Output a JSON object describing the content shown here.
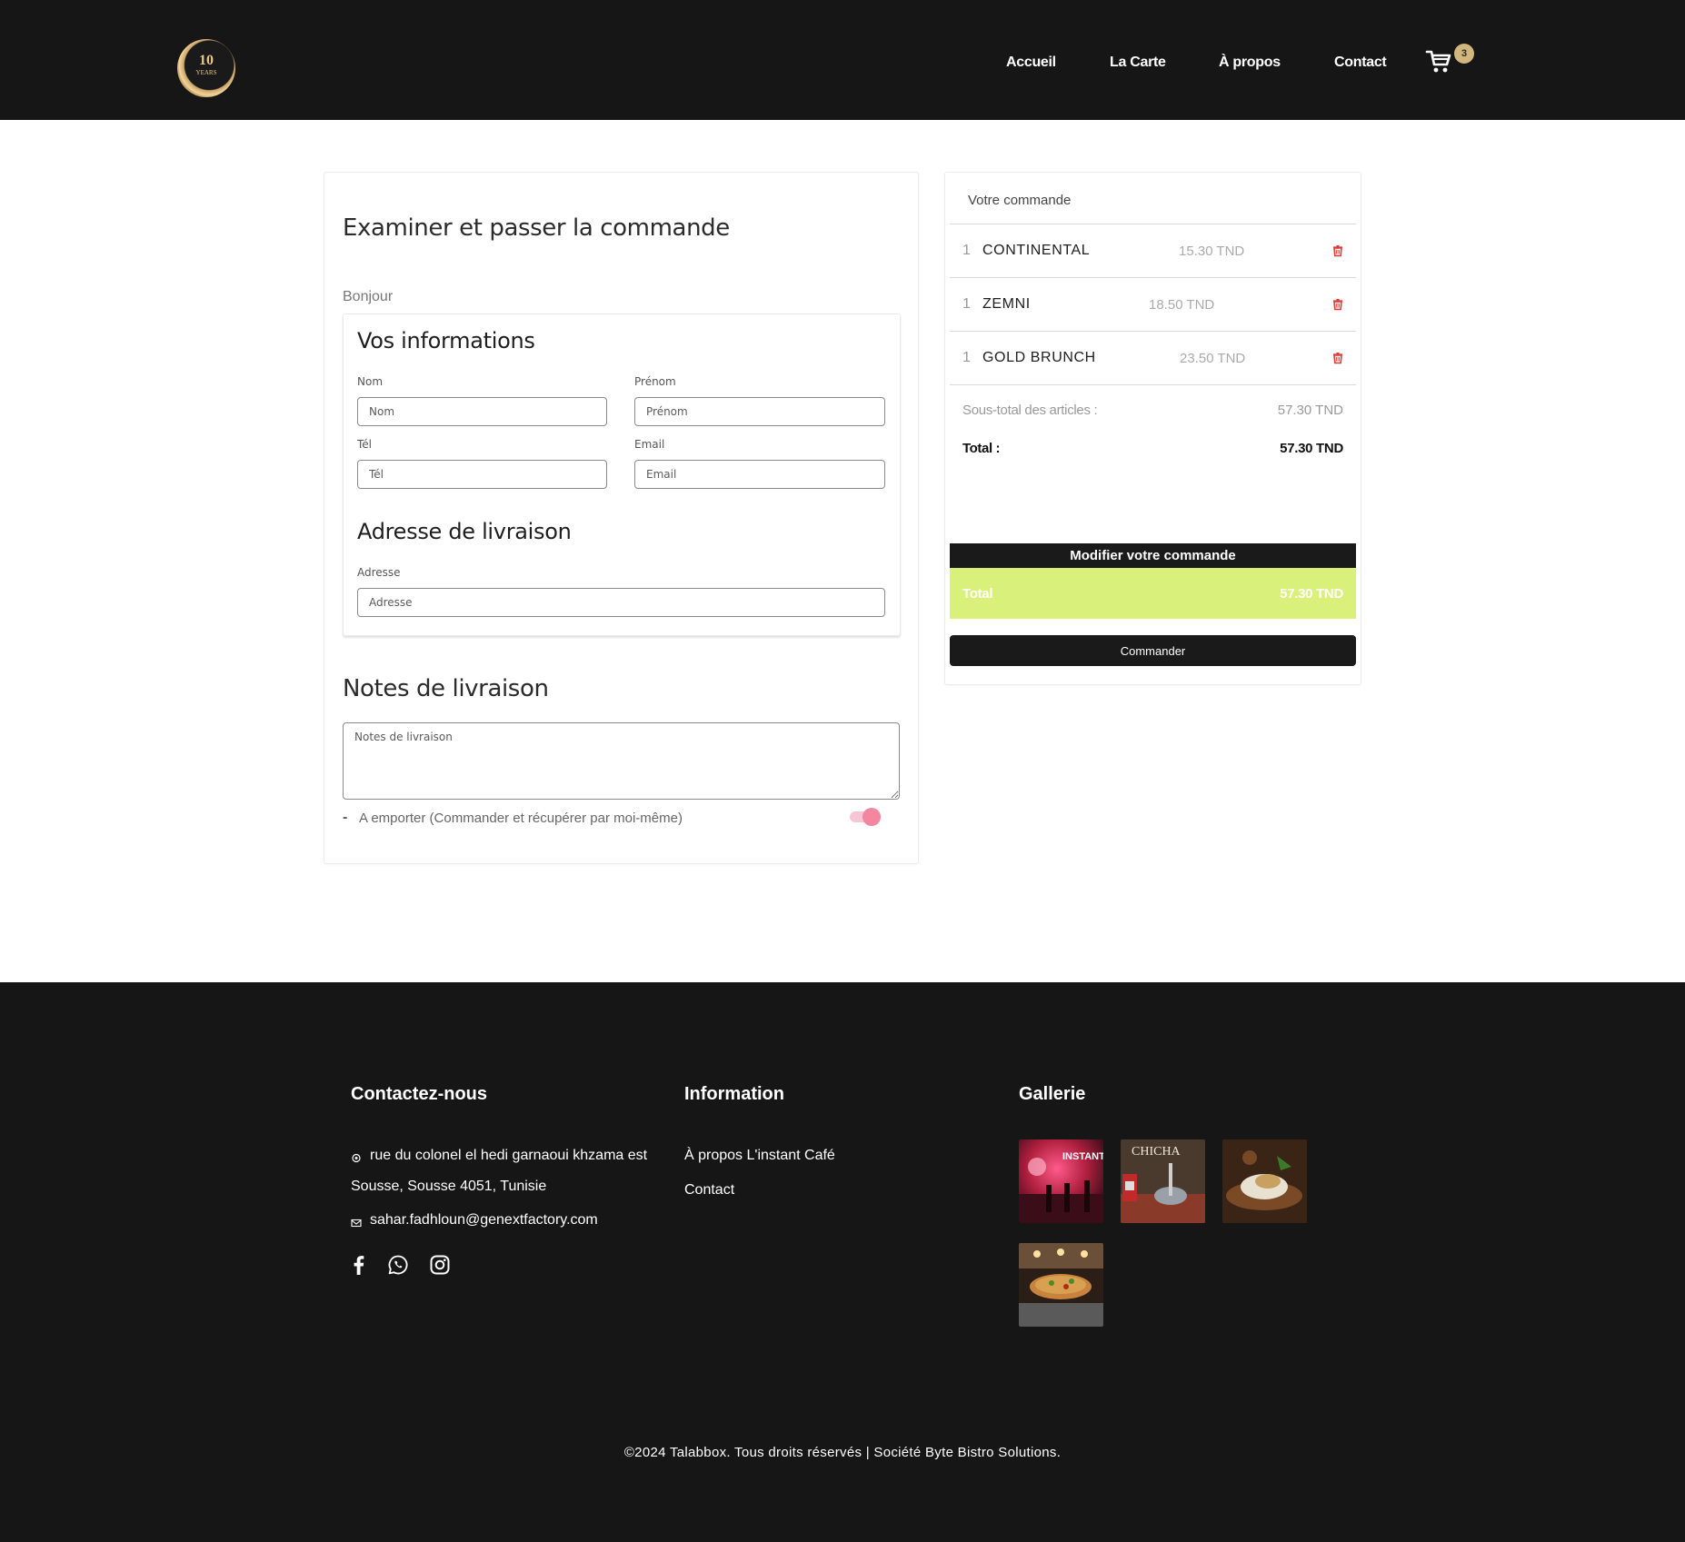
{
  "header": {
    "logo_text": "10",
    "logo_sub": "YEARS",
    "nav": [
      "Accueil",
      "La Carte",
      "À propos",
      "Contact"
    ],
    "cart_count": "3"
  },
  "checkout": {
    "title": "Examiner et passer la commande",
    "greeting": "Bonjour",
    "info_title": "Vos informations",
    "fields": {
      "nom": {
        "label": "Nom",
        "placeholder": "Nom",
        "value": ""
      },
      "prenom": {
        "label": "Prénom",
        "placeholder": "Prénom",
        "value": ""
      },
      "tel": {
        "label": "Tél",
        "placeholder": "Tél",
        "value": ""
      },
      "email": {
        "label": "Email",
        "placeholder": "Email",
        "value": ""
      }
    },
    "address_title": "Adresse de livraison",
    "address": {
      "label": "Adresse",
      "placeholder": "Adresse",
      "value": ""
    },
    "notes_title": "Notes de livraison",
    "notes_placeholder": "Notes de livraison",
    "takeaway_dash": "-",
    "takeaway_label": "A emporter (Commander et récupérer par moi-même)",
    "takeaway_on": true
  },
  "order": {
    "heading": "Votre commande",
    "items": [
      {
        "qty": "1",
        "name": "CONTINENTAL",
        "price": "15.30 TND"
      },
      {
        "qty": "1",
        "name": "ZEMNI",
        "price": "18.50 TND"
      },
      {
        "qty": "1",
        "name": "GOLD BRUNCH",
        "price": "23.50 TND"
      }
    ],
    "subtotal_label": "Sous-total des articles :",
    "subtotal_value": "57.30 TND",
    "total_label": "Total :",
    "total_value": "57.30 TND",
    "modify_label": "Modifier votre commande",
    "bar_total_label": "Total",
    "bar_total_value": "57.30 TND",
    "order_button": "Commander"
  },
  "footer": {
    "contact_title": "Contactez-nous",
    "address_line1": "rue du colonel el hedi garnaoui khzama est",
    "address_line2": "Sousse, Sousse 4051, Tunisie",
    "email": "sahar.fadhloun@genextfactory.com",
    "info_title": "Information",
    "info_links": [
      "À propos L'instant Café",
      "Contact"
    ],
    "gallery_title": "Gallerie",
    "gallery_captions": [
      "INSTANT",
      "CHICHA"
    ],
    "copyright": "©2024 Talabbox. Tous droits réservés | Société Byte Bistro Solutions."
  },
  "colors": {
    "header_bg": "#161616",
    "accent_green": "#d9f17b",
    "badge_gold": "#d1b67d",
    "trash_red": "#e53935",
    "toggle_pink": "#f2879f"
  }
}
